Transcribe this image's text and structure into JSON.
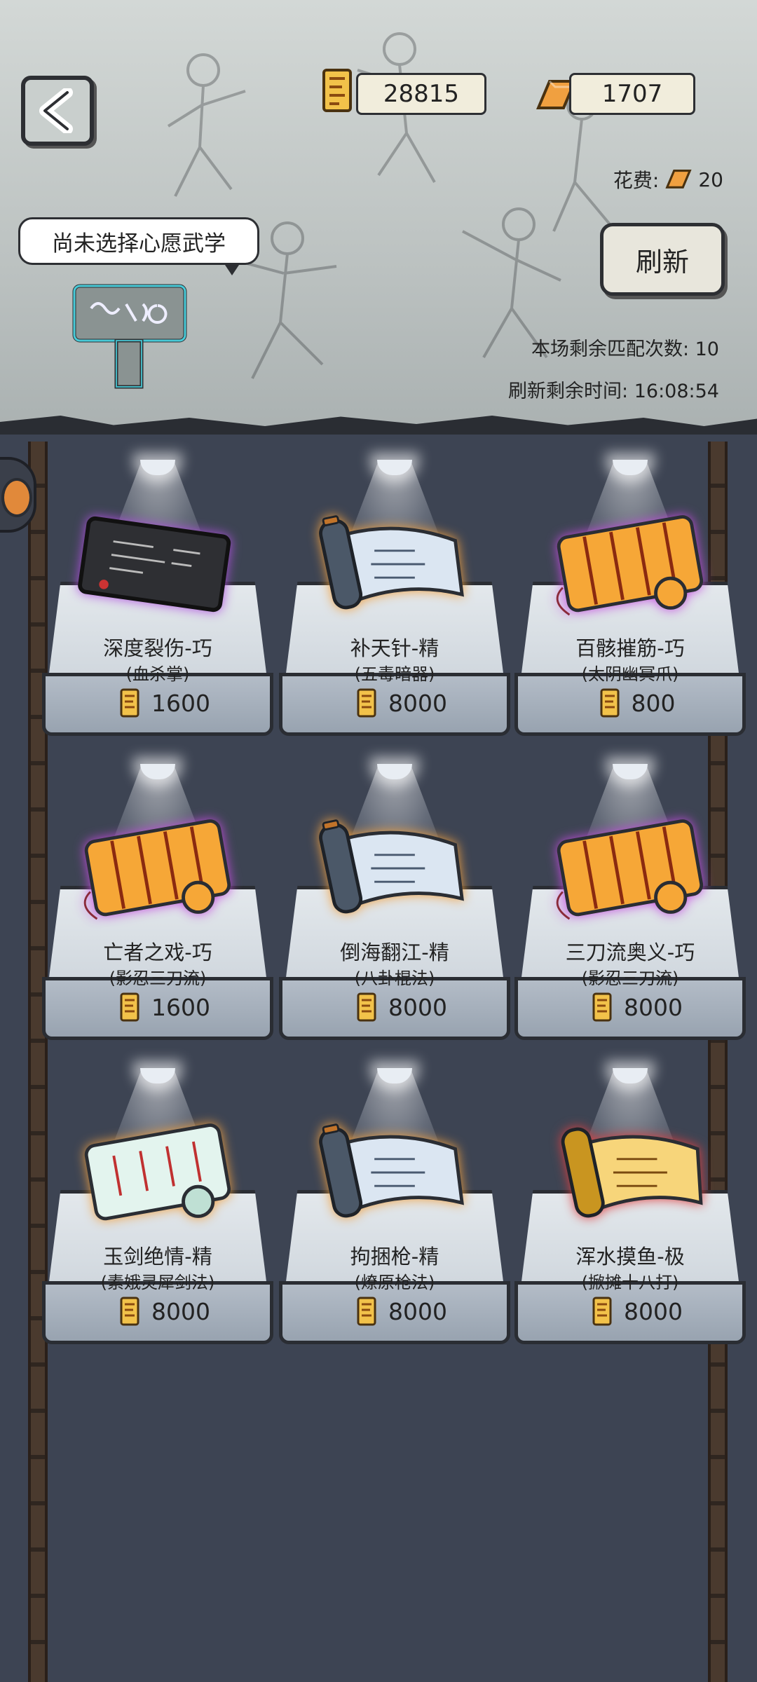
{
  "header": {
    "scroll_currency": "28815",
    "gold_currency": "1707",
    "cost_label": "花费:",
    "cost_value": "20",
    "refresh_label": "刷新",
    "remaining_matches": "本场剩余匹配次数: 10",
    "refresh_timer": "刷新剩余时间: 16:08:54",
    "wish_bubble": "尚未选择心愿武学"
  },
  "items": [
    {
      "name": "深度裂伤-巧",
      "sub": "(血杀掌)",
      "price": "1600",
      "art": "tablet"
    },
    {
      "name": "补天针-精",
      "sub": "(五毒暗器)",
      "price": "8000",
      "art": "blue-scroll"
    },
    {
      "name": "百骸摧筋-巧",
      "sub": "(太阴幽冥爪)",
      "price": "800",
      "art": "orange-scroll"
    },
    {
      "name": "亡者之戏-巧",
      "sub": "(影忍三刀流)",
      "price": "1600",
      "art": "orange-scroll"
    },
    {
      "name": "倒海翻江-精",
      "sub": "(八卦棍法)",
      "price": "8000",
      "art": "blue-scroll"
    },
    {
      "name": "三刀流奥义-巧",
      "sub": "(影忍三刀流)",
      "price": "8000",
      "art": "orange-scroll"
    },
    {
      "name": "玉剑绝情-精",
      "sub": "(素娥灵犀剑法)",
      "price": "8000",
      "art": "jade-scroll"
    },
    {
      "name": "拘捆枪-精",
      "sub": "(燎原枪法)",
      "price": "8000",
      "art": "blue-scroll"
    },
    {
      "name": "浑水摸鱼-极",
      "sub": "(掀摊十八打)",
      "price": "8000",
      "art": "gold-scroll"
    }
  ],
  "colors": {
    "orange": "#f29a32",
    "blue": "#c8d6e6",
    "jade": "#d9efe7",
    "gold": "#f2c24a",
    "purple_glow": "#c44ce0"
  }
}
